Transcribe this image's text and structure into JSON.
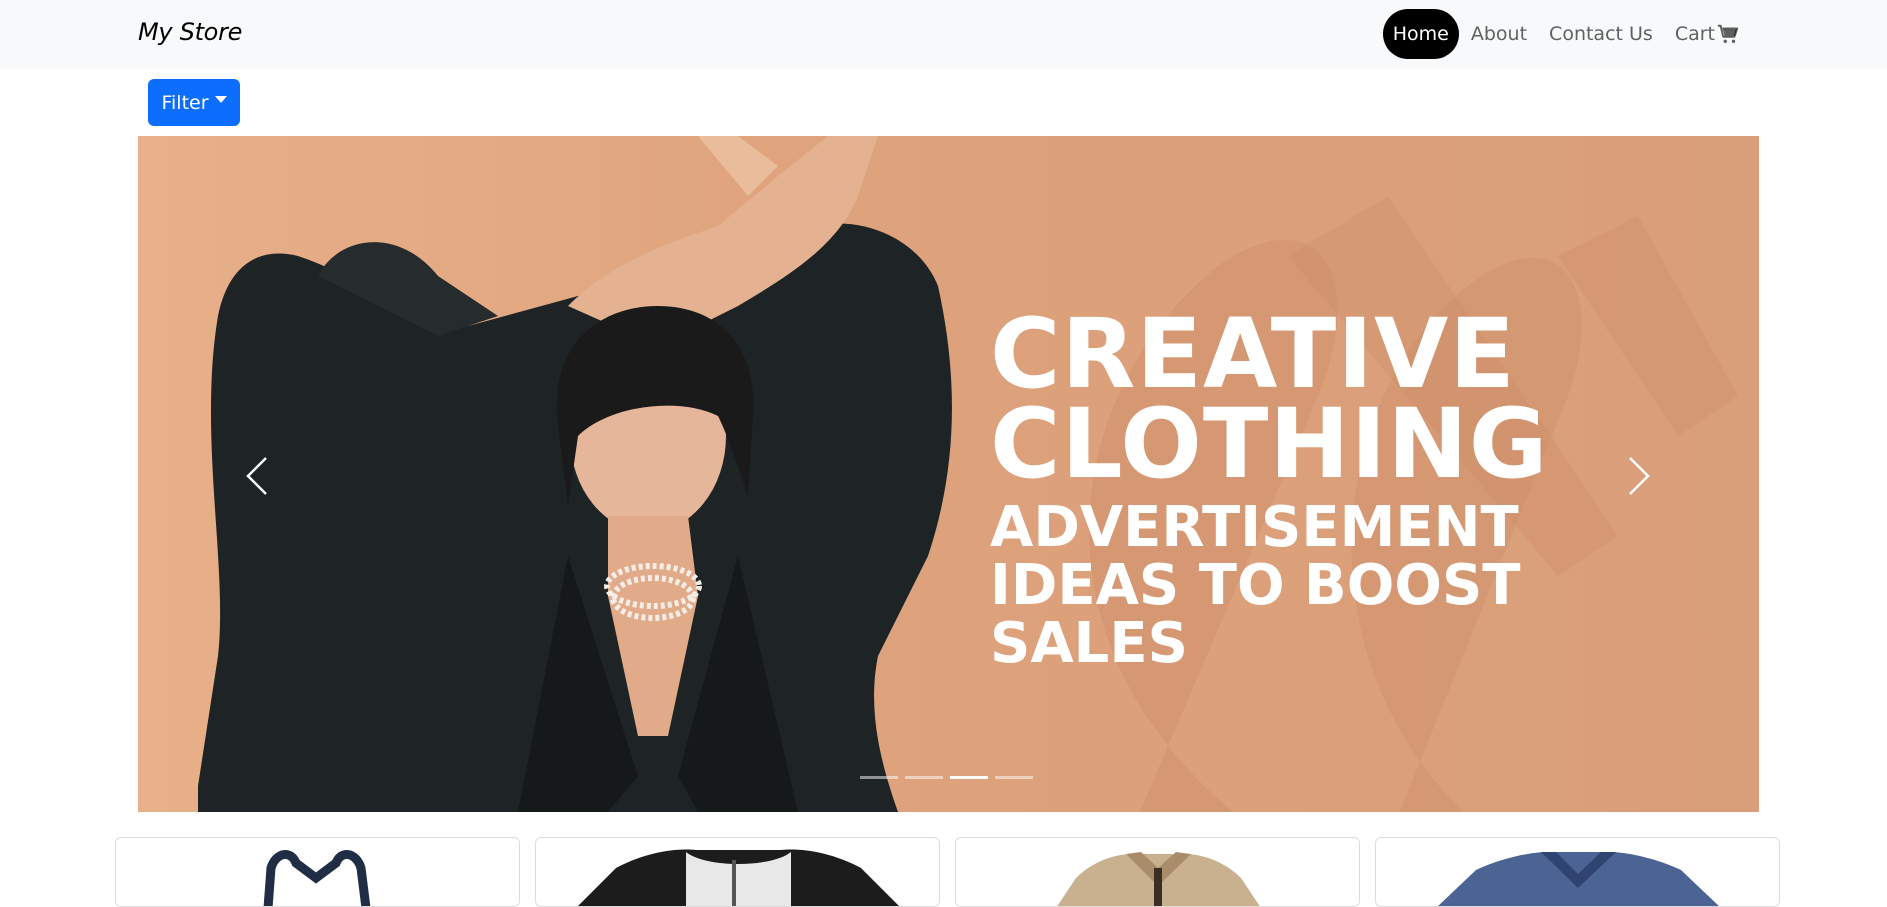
{
  "navbar": {
    "brand": "My Store",
    "links": [
      {
        "label": "Home",
        "active": true
      },
      {
        "label": "About",
        "active": false
      },
      {
        "label": "Contact Us",
        "active": false
      },
      {
        "label": "Cart",
        "active": false,
        "icon": "cart-icon"
      }
    ]
  },
  "filter": {
    "label": "Filter",
    "icon": "caret-down-icon"
  },
  "carousel": {
    "headline": [
      "CREATIVE",
      "CLOTHING",
      "ADVERTISEMENT",
      "IDEAS TO BOOST",
      "SALES"
    ],
    "slide_count": 4,
    "active_slide": 3,
    "prev_icon": "chevron-left-icon",
    "next_icon": "chevron-right-icon"
  },
  "products": [
    {
      "image": "navy-polo-shirt"
    },
    {
      "image": "black-white-raglan-shirt"
    },
    {
      "image": "beige-jacket"
    },
    {
      "image": "blue-vneck-tshirt"
    }
  ],
  "colors": {
    "primary": "#0d6efd",
    "navbar_bg": "#f8f9fa",
    "active_pill": "#000000"
  }
}
